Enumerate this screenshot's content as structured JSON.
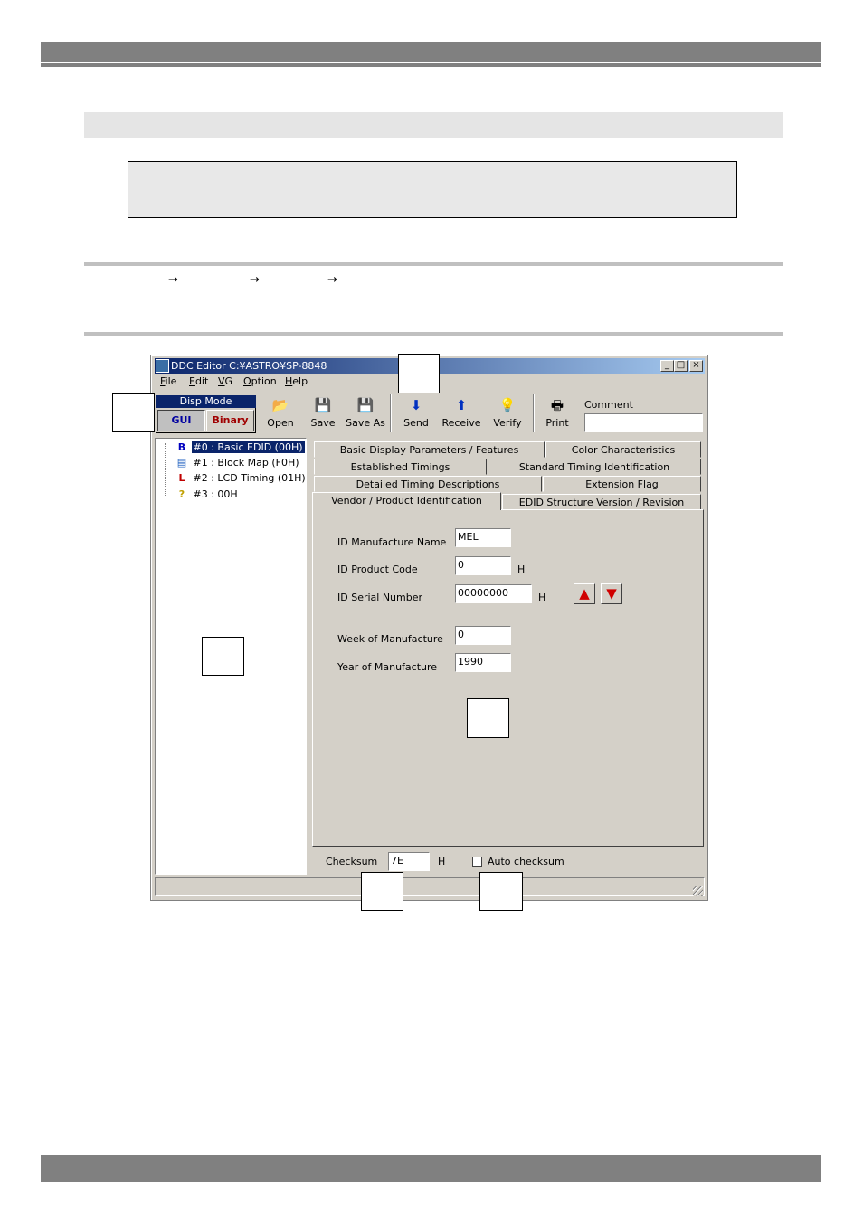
{
  "window": {
    "title": "DDC Editor C:¥ASTRO¥SP-8848",
    "min_glyph": "_",
    "max_glyph": "□",
    "close_glyph": "×"
  },
  "menu": [
    "File",
    "Edit",
    "VG",
    "Option",
    "Help"
  ],
  "disp_mode": {
    "label": "Disp Mode",
    "gui": "GUI",
    "binary": "Binary"
  },
  "toolbar": [
    {
      "label": "Open",
      "icon": "folder-open-icon"
    },
    {
      "label": "Save",
      "icon": "floppy-icon"
    },
    {
      "label": "Save As",
      "icon": "floppy-abc-icon"
    },
    {
      "label": "Send",
      "icon": "arrow-down-icon"
    },
    {
      "label": "Receive",
      "icon": "arrow-up-icon"
    },
    {
      "label": "Verify",
      "icon": "lightbulb-icon"
    },
    {
      "label": "Print",
      "icon": "printer-icon"
    }
  ],
  "comment": {
    "label": "Comment",
    "value": ""
  },
  "tree": [
    {
      "mark": "B",
      "text": "#0 : Basic EDID (00H)",
      "color": "#0000c0"
    },
    {
      "mark": "▤",
      "text": "#1 : Block Map (F0H)",
      "color": "#2060c0"
    },
    {
      "mark": "L",
      "text": "#2 : LCD Timing (01H)",
      "color": "#c00000"
    },
    {
      "mark": "?",
      "text": "#3 : 00H",
      "color": "#c0a000"
    }
  ],
  "tabs": {
    "row1": [
      "Basic Display Parameters / Features",
      "Color Characteristics"
    ],
    "row2": [
      "Established Timings",
      "Standard Timing Identification"
    ],
    "row3": [
      "Detailed Timing Descriptions",
      "Extension Flag"
    ],
    "row4": [
      "Vendor / Product Identification",
      "EDID Structure Version / Revision"
    ]
  },
  "fields": {
    "manufacture_name": {
      "label": "ID Manufacture Name",
      "value": "MEL"
    },
    "product_code": {
      "label": "ID Product Code",
      "value": "0",
      "unit": "H"
    },
    "serial_number": {
      "label": "ID Serial Number",
      "value": "00000000",
      "unit": "H"
    },
    "week": {
      "label": "Week of Manufacture",
      "value": "0"
    },
    "year": {
      "label": "Year of Manufacture",
      "value": "1990"
    }
  },
  "spin": {
    "up": "▲",
    "down": "▼"
  },
  "checksum": {
    "label": "Checksum",
    "value": "7E",
    "unit": "H",
    "auto_label": "Auto checksum"
  },
  "arrows": [
    "→",
    "→",
    "→"
  ]
}
